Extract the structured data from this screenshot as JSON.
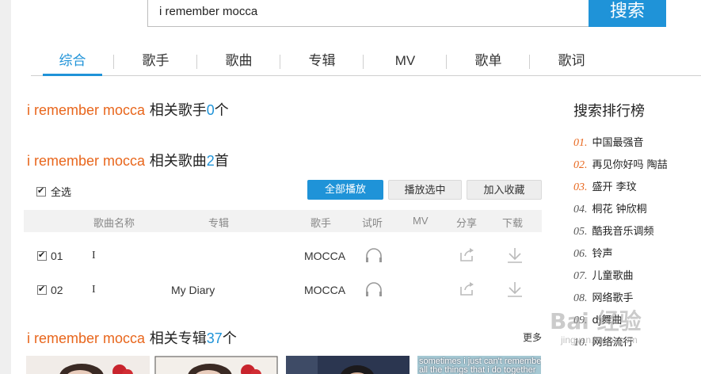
{
  "search": {
    "query": "i remember mocca",
    "button_label": "搜索"
  },
  "tabs": [
    "综合",
    "歌手",
    "歌曲",
    "专辑",
    "MV",
    "歌单",
    "歌词"
  ],
  "artists_section": {
    "query": "i remember mocca",
    "label": "相关歌手",
    "count": "0",
    "unit": "个"
  },
  "songs_section": {
    "query": "i remember mocca",
    "label": "相关歌曲",
    "count": "2",
    "unit": "首",
    "select_all_label": "全选",
    "buttons": {
      "play_all": "全部播放",
      "play_selected": "播放选中",
      "add_favorite": "加入收藏"
    },
    "columns": [
      "歌曲名称",
      "专辑",
      "歌手",
      "试听",
      "MV",
      "分享",
      "下载"
    ],
    "rows": [
      {
        "index": "01",
        "title": "I",
        "album": "",
        "artist": "MOCCA"
      },
      {
        "index": "02",
        "title": "I",
        "album": "My Diary",
        "artist": "MOCCA"
      }
    ]
  },
  "albums_section": {
    "query": "i remember mocca",
    "label": "相关专辑",
    "count": "37",
    "unit": "个",
    "more_label": "更多",
    "album4_caption_line1": "sometimes i just can't remember",
    "album4_caption_line2": "all the things that i do together"
  },
  "ranking": {
    "title": "搜索排行榜",
    "items": [
      {
        "num": "01.",
        "label": "中国最强音"
      },
      {
        "num": "02.",
        "label": "再见你好吗 陶喆"
      },
      {
        "num": "03.",
        "label": "盛开 李玟"
      },
      {
        "num": "04.",
        "label": "桐花 钟欣桐"
      },
      {
        "num": "05.",
        "label": "酷我音乐调频"
      },
      {
        "num": "06.",
        "label": "铃声"
      },
      {
        "num": "07.",
        "label": "儿童歌曲"
      },
      {
        "num": "08.",
        "label": "网络歌手"
      },
      {
        "num": "09.",
        "label": "dj舞曲"
      },
      {
        "num": "10.",
        "label": "网络流行"
      }
    ]
  },
  "watermark": {
    "text": "Bai 经验",
    "url": "jingyan.baidu.com"
  },
  "colors": {
    "accent": "#1f93d8",
    "query": "#e8661c"
  }
}
